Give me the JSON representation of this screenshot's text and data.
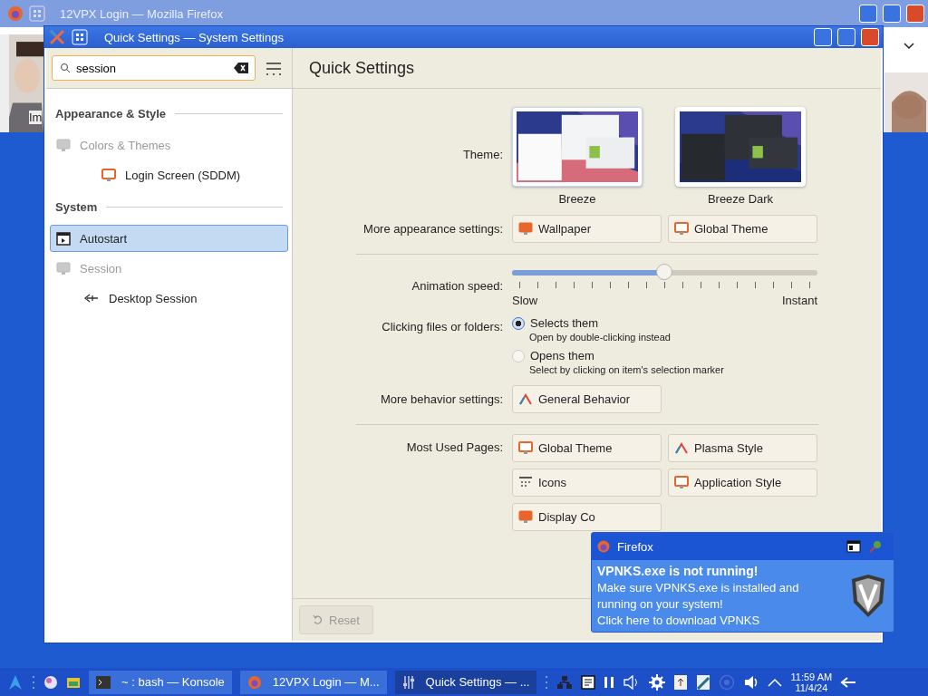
{
  "firefox_window": {
    "title": "12VPX Login — Mozilla Firefox",
    "page_text": "Im"
  },
  "settings_window": {
    "title": "Quick Settings — System Settings"
  },
  "search": {
    "value": "session"
  },
  "sidebar": {
    "sections": [
      {
        "title": "Appearance & Style",
        "items": [
          {
            "label": "Colors & Themes",
            "selected": false,
            "disabled": true,
            "children": [
              {
                "label": "Login Screen (SDDM)",
                "selected": false,
                "disabled": false
              }
            ]
          }
        ]
      },
      {
        "title": "System",
        "items": [
          {
            "label": "Autostart",
            "selected": true,
            "disabled": false
          },
          {
            "label": "Session",
            "selected": false,
            "disabled": true,
            "children": [
              {
                "label": "Desktop Session",
                "selected": false,
                "disabled": false
              }
            ]
          }
        ]
      }
    ]
  },
  "main": {
    "title": "Quick Settings",
    "theme": {
      "label": "Theme:",
      "options": [
        {
          "name": "Breeze",
          "selected": true
        },
        {
          "name": "Breeze Dark",
          "selected": false
        }
      ]
    },
    "appearance": {
      "label": "More appearance settings:",
      "buttons": [
        "Wallpaper",
        "Global Theme"
      ]
    },
    "animation": {
      "label": "Animation speed:",
      "level": 0.5,
      "min_label": "Slow",
      "max_label": "Instant"
    },
    "clicking": {
      "label": "Clicking files or folders:",
      "options": [
        {
          "label": "Selects them",
          "hint": "Open by double-clicking instead",
          "selected": true
        },
        {
          "label": "Opens them",
          "hint": "Select by clicking on item's selection marker",
          "selected": false
        }
      ]
    },
    "behavior": {
      "label": "More behavior settings:",
      "buttons": [
        "General Behavior"
      ]
    },
    "most_used": {
      "label": "Most Used Pages:",
      "buttons": [
        "Global Theme",
        "Plasma Style",
        "Icons",
        "Application Style",
        "Display Co"
      ]
    },
    "reset": {
      "label": "Reset",
      "disabled": true
    }
  },
  "notification": {
    "app": "Firefox",
    "title": "VPNKS.exe is not running!",
    "body": "Make sure VPNKS.exe is installed and running on your system!",
    "link": "Click here to download VPNKS"
  },
  "taskbar": {
    "tasks": [
      {
        "label": "~ : bash — Konsole",
        "selected": false
      },
      {
        "label": "12VPX Login — M...",
        "selected": false
      },
      {
        "label": "Quick Settings — ...",
        "selected": true
      }
    ],
    "time": "11:59 AM",
    "date": "11/4/24"
  }
}
